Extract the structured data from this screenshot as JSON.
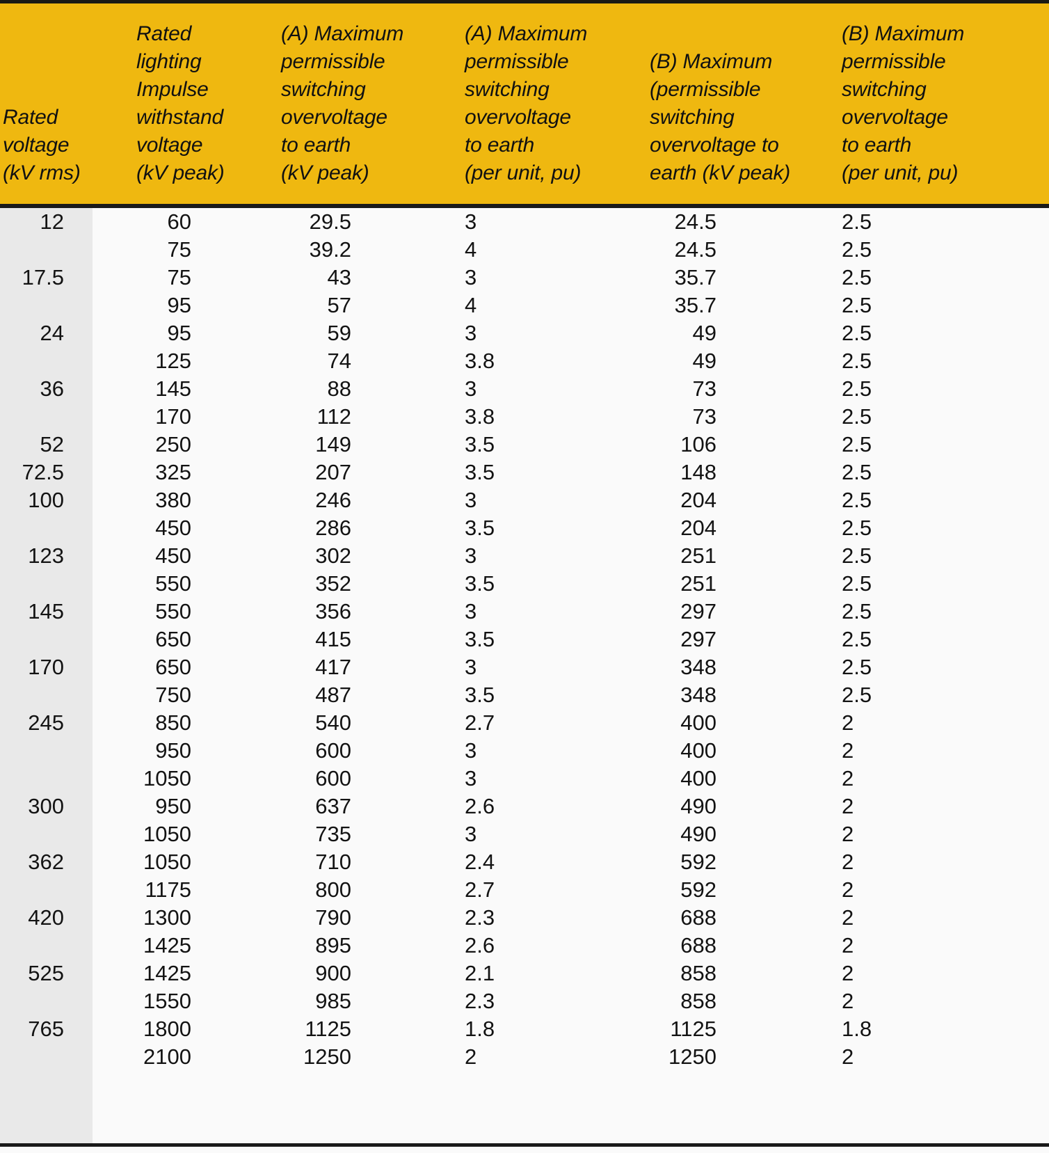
{
  "colors": {
    "header_background": "#efb810",
    "row_stripe": "#e9e9e9",
    "body_background": "#fafafa",
    "rule": "#1a1a1a",
    "text": "#131313"
  },
  "table": {
    "headers": [
      "Rated\nvoltage\n(kV rms)",
      "Rated\nlighting\nImpulse\nwithstand\nvoltage\n(kV peak)",
      "(A) Maximum\npermissible\nswitching\novervoltage\nto earth\n(kV peak)",
      "(A) Maximum\npermissible\nswitching\novervoltage\nto earth\n(per unit, pu)",
      "(B) Maximum\n(permissible\nswitching\novervoltage to\nearth (kV peak)",
      "(B) Maximum\npermissible\nswitching\novervoltage\nto earth\n(per unit, pu)"
    ],
    "rows": [
      [
        "12",
        "60",
        "29.5",
        "3",
        "24.5",
        "2.5"
      ],
      [
        "",
        "75",
        "39.2",
        "4",
        "24.5",
        "2.5"
      ],
      [
        "17.5",
        "75",
        "43",
        "3",
        "35.7",
        "2.5"
      ],
      [
        "",
        "95",
        "57",
        "4",
        "35.7",
        "2.5"
      ],
      [
        "24",
        "95",
        "59",
        "3",
        "49",
        "2.5"
      ],
      [
        "",
        "125",
        "74",
        "3.8",
        "49",
        "2.5"
      ],
      [
        "36",
        "145",
        "88",
        "3",
        "73",
        "2.5"
      ],
      [
        "",
        "170",
        "112",
        "3.8",
        "73",
        "2.5"
      ],
      [
        "52",
        "250",
        "149",
        "3.5",
        "106",
        "2.5"
      ],
      [
        "72.5",
        "325",
        "207",
        "3.5",
        "148",
        "2.5"
      ],
      [
        "100",
        "380",
        "246",
        "3",
        "204",
        "2.5"
      ],
      [
        "",
        "450",
        "286",
        "3.5",
        "204",
        "2.5"
      ],
      [
        "123",
        "450",
        "302",
        "3",
        "251",
        "2.5"
      ],
      [
        "",
        "550",
        "352",
        "3.5",
        "251",
        "2.5"
      ],
      [
        "145",
        "550",
        "356",
        "3",
        "297",
        "2.5"
      ],
      [
        "",
        "650",
        "415",
        "3.5",
        "297",
        "2.5"
      ],
      [
        "170",
        "650",
        "417",
        "3",
        "348",
        "2.5"
      ],
      [
        "",
        "750",
        "487",
        "3.5",
        "348",
        "2.5"
      ],
      [
        "245",
        "850",
        "540",
        "2.7",
        "400",
        "2"
      ],
      [
        "",
        "950",
        "600",
        "3",
        "400",
        "2"
      ],
      [
        "",
        "1050",
        "600",
        "3",
        "400",
        "2"
      ],
      [
        "300",
        "950",
        "637",
        "2.6",
        "490",
        "2"
      ],
      [
        "",
        "1050",
        "735",
        "3",
        "490",
        "2"
      ],
      [
        "362",
        "1050",
        "710",
        "2.4",
        "592",
        "2"
      ],
      [
        "",
        "1175",
        "800",
        "2.7",
        "592",
        "2"
      ],
      [
        "420",
        "1300",
        "790",
        "2.3",
        "688",
        "2"
      ],
      [
        "",
        "1425",
        "895",
        "2.6",
        "688",
        "2"
      ],
      [
        "525",
        "1425",
        "900",
        "2.1",
        "858",
        "2"
      ],
      [
        "",
        "1550",
        "985",
        "2.3",
        "858",
        "2"
      ],
      [
        "765",
        "1800",
        "1125",
        "1.8",
        "1125",
        "1.8"
      ],
      [
        "",
        "2100",
        "1250",
        "2",
        "1250",
        "2"
      ]
    ]
  }
}
